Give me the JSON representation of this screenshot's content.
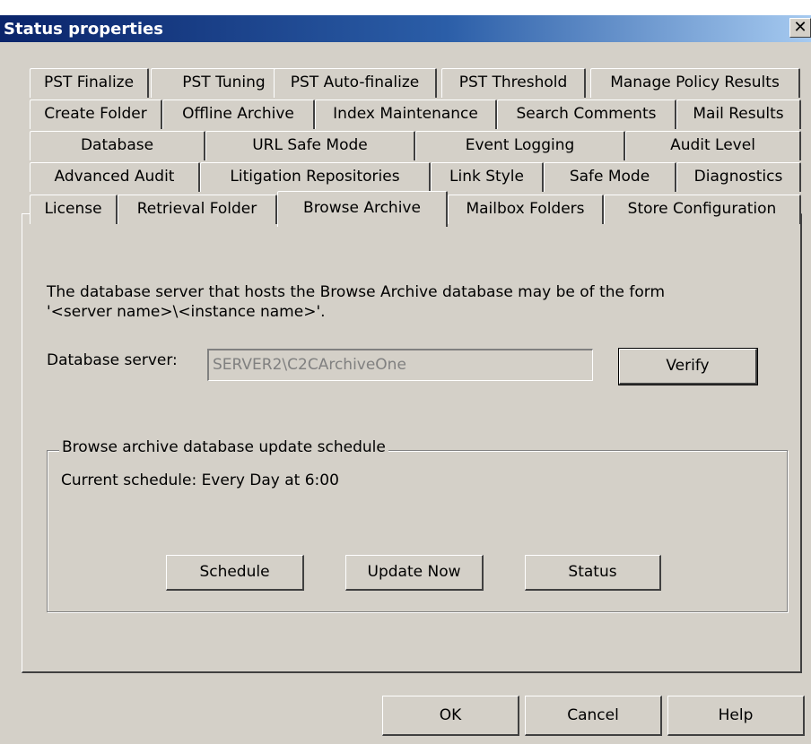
{
  "window": {
    "title": "Status properties",
    "close_glyph": "✕"
  },
  "tabs": {
    "row1": [
      "PST Finalize",
      "PST Tuning",
      "PST Auto-finalize",
      "PST Threshold",
      "Manage Policy Results"
    ],
    "row2": [
      "Create Folder",
      "Offline Archive",
      "Index Maintenance",
      "Search Comments",
      "Mail Results"
    ],
    "row3": [
      "Database",
      "URL Safe Mode",
      "Event Logging",
      "Audit Level"
    ],
    "row4": [
      "Advanced Audit",
      "Litigation Repositories",
      "Link Style",
      "Safe Mode",
      "Diagnostics"
    ],
    "row5": [
      "License",
      "Retrieval Folder",
      "Browse Archive",
      "Mailbox Folders",
      "Store Configuration"
    ],
    "active": "Browse Archive"
  },
  "panel": {
    "description_line1": "The database server that hosts the Browse Archive database may be of the form",
    "description_line2": "'<server name>\\<instance name>'.",
    "server_label": "Database server:",
    "server_value": "SERVER2\\C2CArchiveOne",
    "verify_label": "Verify",
    "group_title": "Browse archive database update schedule",
    "current_schedule": "Current schedule: Every Day at 6:00",
    "schedule_label": "Schedule",
    "update_now_label": "Update Now",
    "status_label": "Status"
  },
  "footer": {
    "ok_label": "OK",
    "cancel_label": "Cancel",
    "help_label": "Help"
  }
}
